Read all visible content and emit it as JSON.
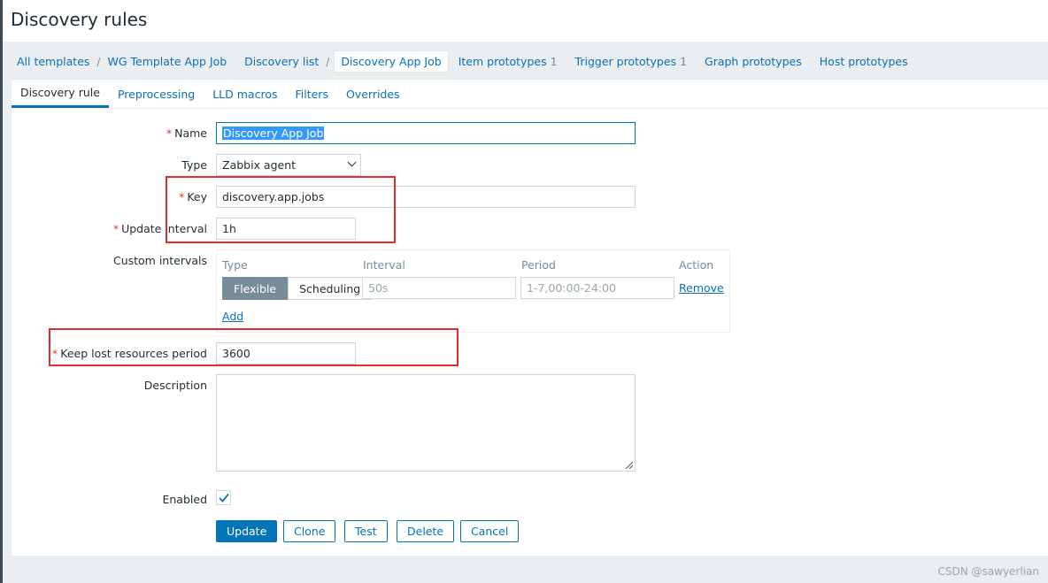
{
  "header": {
    "title": "Discovery rules"
  },
  "breadcrumbs": [
    {
      "label": "All templates",
      "count": ""
    },
    {
      "label": "WG Template App Job",
      "count": ""
    },
    {
      "label": "Discovery list",
      "count": ""
    },
    {
      "label": "Discovery App Job",
      "count": "",
      "selected": true
    },
    {
      "label": "Item prototypes",
      "count": "1"
    },
    {
      "label": "Trigger prototypes",
      "count": "1"
    },
    {
      "label": "Graph prototypes",
      "count": ""
    },
    {
      "label": "Host prototypes",
      "count": ""
    }
  ],
  "breadcrumb_separator": "/",
  "tabs": [
    "Discovery rule",
    "Preprocessing",
    "LLD macros",
    "Filters",
    "Overrides"
  ],
  "form": {
    "required_mark": "*",
    "name": {
      "label": "Name",
      "value": "Discovery App Job"
    },
    "type": {
      "label": "Type",
      "value": "Zabbix agent"
    },
    "key": {
      "label": "Key",
      "value": "discovery.app.jobs"
    },
    "update_interval": {
      "label": "Update interval",
      "value": "1h"
    },
    "custom_intervals": {
      "label": "Custom intervals",
      "headers": [
        "Type",
        "Interval",
        "Period",
        "Action"
      ],
      "type_options": [
        "Flexible",
        "Scheduling"
      ],
      "type_selected": "Flexible",
      "interval_placeholder": "50s",
      "period_placeholder": "1-7,00:00-24:00",
      "remove_label": "Remove",
      "add_label": "Add"
    },
    "keep_lost": {
      "label": "Keep lost resources period",
      "value": "3600"
    },
    "description": {
      "label": "Description",
      "value": ""
    },
    "enabled": {
      "label": "Enabled",
      "checked": true
    }
  },
  "buttons": {
    "update": "Update",
    "clone": "Clone",
    "test": "Test",
    "delete": "Delete",
    "cancel": "Cancel"
  },
  "watermark": "CSDN @sawyerlian",
  "colors": {
    "accent": "#0275b8",
    "highlight": "#e32d2d",
    "required": "#e33734"
  }
}
